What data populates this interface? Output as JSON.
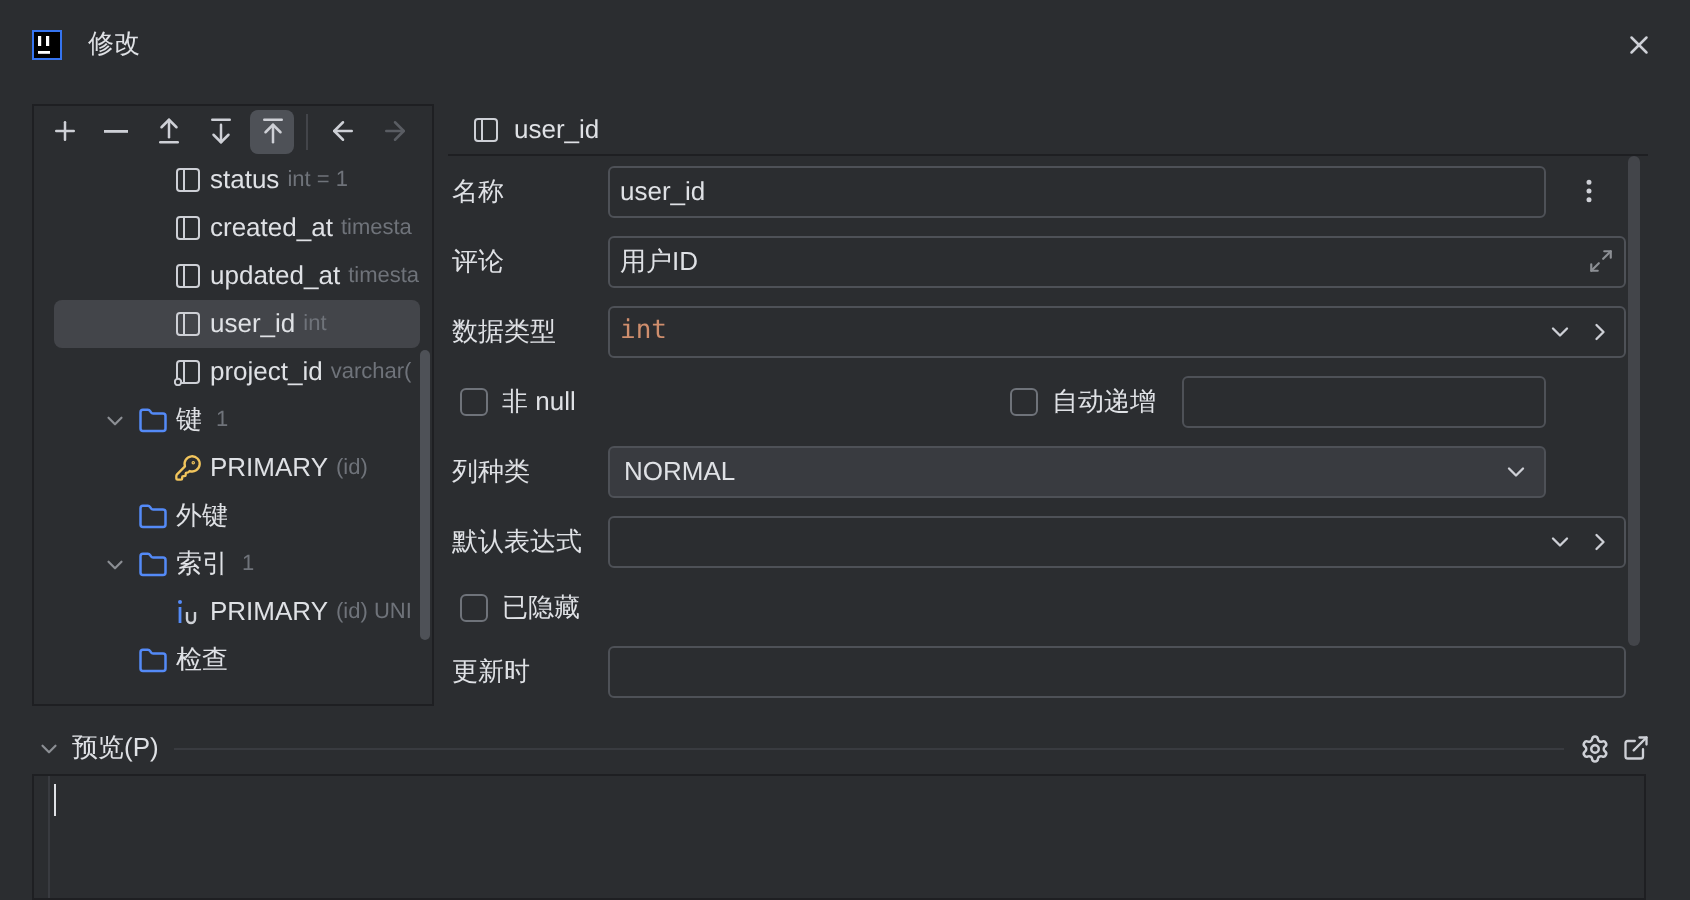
{
  "window": {
    "title": "修改"
  },
  "toolbar": [
    {
      "kind": "add",
      "selected": false,
      "disabled": false
    },
    {
      "kind": "remove",
      "selected": false,
      "disabled": false
    },
    {
      "kind": "move-up",
      "selected": false,
      "disabled": false
    },
    {
      "kind": "move-down",
      "selected": false,
      "disabled": false
    },
    {
      "kind": "move-top",
      "selected": true,
      "disabled": false
    },
    {
      "kind": "back",
      "selected": false,
      "disabled": false
    },
    {
      "kind": "forward",
      "selected": false,
      "disabled": true
    }
  ],
  "tree": [
    {
      "kind": "column",
      "label": "status",
      "detail": "int = 1",
      "selected": false
    },
    {
      "kind": "column",
      "label": "created_at",
      "detail": "timesta",
      "selected": false
    },
    {
      "kind": "column",
      "label": "updated_at",
      "detail": "timesta",
      "selected": false
    },
    {
      "kind": "column",
      "label": "user_id",
      "detail": "int",
      "selected": true
    },
    {
      "kind": "fk-column",
      "label": "project_id",
      "detail": "varchar(",
      "selected": false
    },
    {
      "kind": "folder",
      "label": "键",
      "count": "1",
      "expanded": true,
      "selected": false,
      "children": [
        {
          "kind": "key",
          "label": "PRIMARY",
          "detail": "(id)",
          "selected": false
        }
      ]
    },
    {
      "kind": "folder",
      "label": "外键",
      "selected": false
    },
    {
      "kind": "folder",
      "label": "索引",
      "count": "1",
      "expanded": true,
      "selected": false,
      "children": [
        {
          "kind": "index",
          "label": "PRIMARY",
          "detail": "(id) UNI",
          "selected": false
        }
      ]
    },
    {
      "kind": "folder",
      "label": "检查",
      "selected": false
    }
  ],
  "editor": {
    "title": "user_id",
    "rows": [
      {
        "kind": "text",
        "label": "名称",
        "value": "user_id",
        "menu": true
      },
      {
        "kind": "expandable",
        "label": "评论",
        "value": "用户ID"
      },
      {
        "kind": "type",
        "label": "数据类型",
        "value": "int"
      },
      {
        "kind": "checks",
        "label": "非 null",
        "checked": false,
        "label2": "自动递增",
        "checked2": false
      },
      {
        "kind": "select",
        "label": "列种类",
        "value": "NORMAL"
      },
      {
        "kind": "type",
        "label": "默认表达式"
      },
      {
        "kind": "check",
        "label": "已隐藏",
        "checked": false
      },
      {
        "kind": "plain",
        "label": "更新时"
      }
    ]
  },
  "preview": {
    "title": "预览(P)",
    "expanded": true
  }
}
